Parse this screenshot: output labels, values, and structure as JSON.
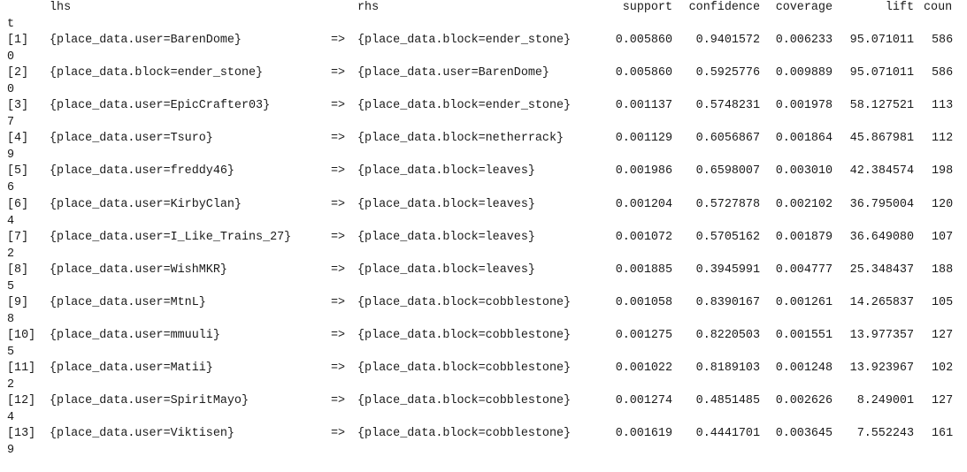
{
  "header": {
    "lhs": "lhs",
    "rhs": "rhs",
    "support": "support",
    "confidence": "confidence",
    "coverage": "coverage",
    "lift": "lift",
    "count_part1": "coun",
    "count_part2": "t"
  },
  "arrow": "=>",
  "rows": [
    {
      "idx": "[1]",
      "lhs": "{place_data.user=BarenDome}",
      "rhs": "{place_data.block=ender_stone}",
      "support": "0.005860",
      "confidence": "0.9401572",
      "coverage": "0.006233",
      "lift": "95.071011",
      "count_part1": "586",
      "count_part2": "0"
    },
    {
      "idx": "[2]",
      "lhs": "{place_data.block=ender_stone}",
      "rhs": "{place_data.user=BarenDome}",
      "support": "0.005860",
      "confidence": "0.5925776",
      "coverage": "0.009889",
      "lift": "95.071011",
      "count_part1": "586",
      "count_part2": "0"
    },
    {
      "idx": "[3]",
      "lhs": "{place_data.user=EpicCrafter03}",
      "rhs": "{place_data.block=ender_stone}",
      "support": "0.001137",
      "confidence": "0.5748231",
      "coverage": "0.001978",
      "lift": "58.127521",
      "count_part1": "113",
      "count_part2": "7"
    },
    {
      "idx": "[4]",
      "lhs": "{place_data.user=Tsuro}",
      "rhs": "{place_data.block=netherrack}",
      "support": "0.001129",
      "confidence": "0.6056867",
      "coverage": "0.001864",
      "lift": "45.867981",
      "count_part1": "112",
      "count_part2": "9"
    },
    {
      "idx": "[5]",
      "lhs": "{place_data.user=freddy46}",
      "rhs": "{place_data.block=leaves}",
      "support": "0.001986",
      "confidence": "0.6598007",
      "coverage": "0.003010",
      "lift": "42.384574",
      "count_part1": "198",
      "count_part2": "6"
    },
    {
      "idx": "[6]",
      "lhs": "{place_data.user=KirbyClan}",
      "rhs": "{place_data.block=leaves}",
      "support": "0.001204",
      "confidence": "0.5727878",
      "coverage": "0.002102",
      "lift": "36.795004",
      "count_part1": "120",
      "count_part2": "4"
    },
    {
      "idx": "[7]",
      "lhs": "{place_data.user=I_Like_Trains_27}",
      "rhs": "{place_data.block=leaves}",
      "support": "0.001072",
      "confidence": "0.5705162",
      "coverage": "0.001879",
      "lift": "36.649080",
      "count_part1": "107",
      "count_part2": "2"
    },
    {
      "idx": "[8]",
      "lhs": "{place_data.user=WishMKR}",
      "rhs": "{place_data.block=leaves}",
      "support": "0.001885",
      "confidence": "0.3945991",
      "coverage": "0.004777",
      "lift": "25.348437",
      "count_part1": "188",
      "count_part2": "5"
    },
    {
      "idx": "[9]",
      "lhs": "{place_data.user=MtnL}",
      "rhs": "{place_data.block=cobblestone}",
      "support": "0.001058",
      "confidence": "0.8390167",
      "coverage": "0.001261",
      "lift": "14.265837",
      "count_part1": "105",
      "count_part2": "8"
    },
    {
      "idx": "[10]",
      "lhs": "{place_data.user=mmuuli}",
      "rhs": "{place_data.block=cobblestone}",
      "support": "0.001275",
      "confidence": "0.8220503",
      "coverage": "0.001551",
      "lift": "13.977357",
      "count_part1": "127",
      "count_part2": "5"
    },
    {
      "idx": "[11]",
      "lhs": "{place_data.user=Matii}",
      "rhs": "{place_data.block=cobblestone}",
      "support": "0.001022",
      "confidence": "0.8189103",
      "coverage": "0.001248",
      "lift": "13.923967",
      "count_part1": "102",
      "count_part2": "2"
    },
    {
      "idx": "[12]",
      "lhs": "{place_data.user=SpiritMayo}",
      "rhs": "{place_data.block=cobblestone}",
      "support": "0.001274",
      "confidence": "0.4851485",
      "coverage": "0.002626",
      "lift": "8.249001",
      "count_part1": "127",
      "count_part2": "4"
    },
    {
      "idx": "[13]",
      "lhs": "{place_data.user=Viktisen}",
      "rhs": "{place_data.block=cobblestone}",
      "support": "0.001619",
      "confidence": "0.4441701",
      "coverage": "0.003645",
      "lift": "7.552243",
      "count_part1": "161",
      "count_part2": "9"
    }
  ]
}
